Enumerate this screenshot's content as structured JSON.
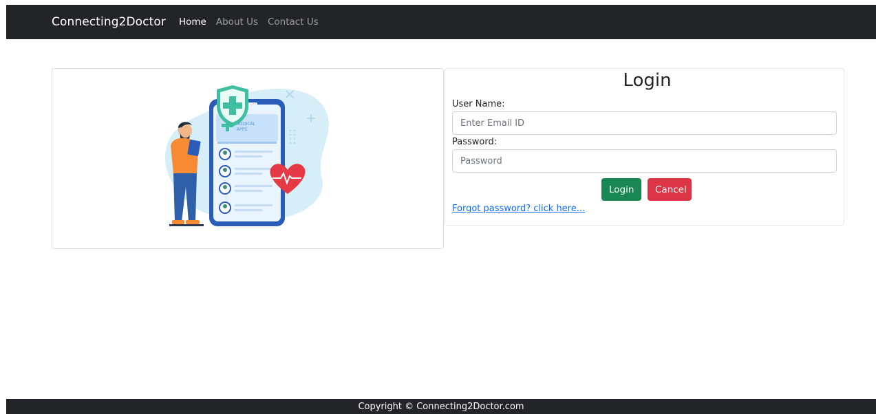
{
  "navbar": {
    "brand": "Connecting2Doctor",
    "links": [
      {
        "label": "Home",
        "active": true
      },
      {
        "label": "About Us",
        "active": false
      },
      {
        "label": "Contact Us",
        "active": false
      }
    ]
  },
  "illustration": {
    "icon": "medical-app-illustration",
    "phone_text_1": "MEDICAL",
    "phone_text_2": "APPS"
  },
  "login": {
    "title": "Login",
    "username_label": "User Name:",
    "username_placeholder": "Enter Email ID",
    "username_value": "",
    "password_label": "Password:",
    "password_placeholder": "Password",
    "password_value": "",
    "login_button": "Login",
    "cancel_button": "Cancel",
    "forgot_link": "Forgot password? click here..."
  },
  "footer": {
    "copyright": "Copyright © Connecting2Doctor.com"
  },
  "colors": {
    "navbar_bg": "#212529",
    "login_button": "#198754",
    "cancel_button": "#dc3545",
    "link": "#0d6efd"
  }
}
